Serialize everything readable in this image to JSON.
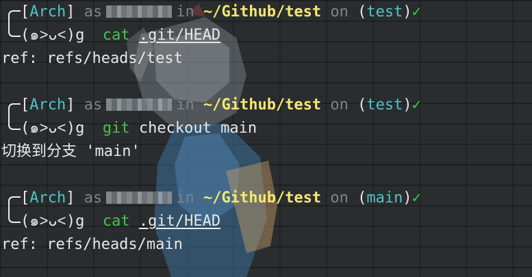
{
  "terminal": {
    "blocks": [
      {
        "prompt": {
          "distro": "Arch",
          "as_word": "as",
          "in_word": "in",
          "path": "~/Github/test",
          "on_word": "on",
          "branch": "test",
          "status_mark": "✓",
          "face": "(๑˃ᴗ˂)g"
        },
        "command": {
          "name": "cat",
          "args": [
            ".git/HEAD"
          ]
        },
        "output": "ref: refs/heads/test"
      },
      {
        "prompt": {
          "distro": "Arch",
          "as_word": "as",
          "in_word": "in",
          "path": "~/Github/test",
          "on_word": "on",
          "branch": "test",
          "status_mark": "✓",
          "face": "(๑˃ᴗ˂)g"
        },
        "command": {
          "name": "git",
          "args": [
            "checkout",
            "main"
          ]
        },
        "output": "切换到分支 'main'"
      },
      {
        "prompt": {
          "distro": "Arch",
          "as_word": "as",
          "in_word": "in",
          "path": "~/Github/test",
          "on_word": "on",
          "branch": "main",
          "status_mark": "✓",
          "face": "(๑˃ᴗ˂)g"
        },
        "command": {
          "name": "cat",
          "args": [
            ".git/HEAD"
          ]
        },
        "output": "ref: refs/heads/main"
      }
    ]
  },
  "colors": {
    "background": "#2a2d2f",
    "distro": "#4fc6c4",
    "path": "#f4e86e",
    "command": "#46c24a",
    "check": "#37d237",
    "dim": "#7d8487"
  }
}
